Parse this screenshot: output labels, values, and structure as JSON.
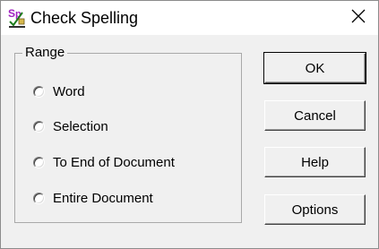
{
  "window": {
    "title": "Check Spelling",
    "icon": "spell-check-app-icon",
    "close_icon": "close-icon"
  },
  "range": {
    "label": "Range",
    "options": [
      {
        "label": "Word",
        "selected": false
      },
      {
        "label": "Selection",
        "selected": false
      },
      {
        "label": "To End of Document",
        "selected": false
      },
      {
        "label": "Entire Document",
        "selected": false
      }
    ]
  },
  "buttons": {
    "ok": "OK",
    "cancel": "Cancel",
    "help": "Help",
    "options": "Options"
  }
}
